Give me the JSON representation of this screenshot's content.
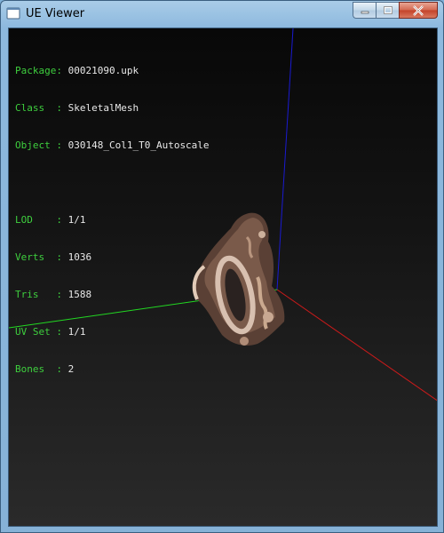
{
  "window": {
    "title": "UE Viewer",
    "app_icon": "ue-viewer-app-icon",
    "buttons": {
      "minimize": "minimize-icon",
      "maximize": "maximize-icon",
      "close": "close-icon"
    }
  },
  "info": {
    "object_block": [
      {
        "key": "Package",
        "pad": " ",
        "value": "00021090.upk"
      },
      {
        "key": "Class  ",
        "pad": " ",
        "value": "SkeletalMesh"
      },
      {
        "key": "Object ",
        "pad": " ",
        "value": "030148_Col1_T0_Autoscale"
      }
    ],
    "stats_block": [
      {
        "key": "LOD    ",
        "pad": " ",
        "value": "1/1"
      },
      {
        "key": "Verts  ",
        "pad": " ",
        "value": "1036"
      },
      {
        "key": "Tris   ",
        "pad": " ",
        "value": "1588"
      },
      {
        "key": "UV Set ",
        "pad": " ",
        "value": "1/1"
      },
      {
        "key": "Bones  ",
        "pad": " ",
        "value": "2"
      }
    ]
  },
  "axes": {
    "x_color": "#cc1a1a",
    "y_color": "#22d822",
    "z_color": "#1a1ad0"
  },
  "colors": {
    "label_key": "#3ecf3e",
    "label_value": "#e8e8e8"
  }
}
